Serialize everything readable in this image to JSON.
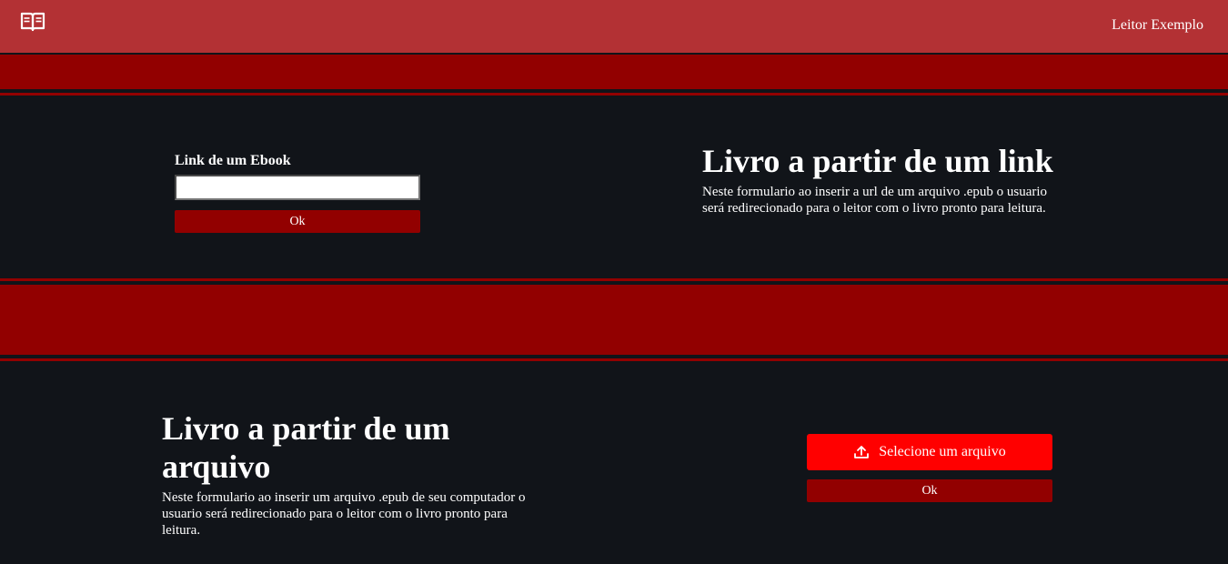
{
  "header": {
    "logo_icon": "open-book-icon",
    "brand": "Leitor Exemplo"
  },
  "link_section": {
    "label": "Link de um Ebook",
    "input_value": "",
    "ok_label": "Ok",
    "title": "Livro a partir de um link",
    "description": "Neste formulario ao inserir a url de um arquivo .epub o usuario será redirecionado para o leitor com o livro pronto para leitura."
  },
  "file_section": {
    "title": "Livro a partir de um arquivo",
    "description": "Neste formulario ao inserir um arquivo .epub de seu computador o usuario será redirecionado para o leitor com o livro pronto para leitura.",
    "select_icon": "upload-icon",
    "select_label": "Selecione um arquivo",
    "ok_label": "Ok"
  },
  "colors": {
    "header_bg": "#b33134",
    "band": "#920000",
    "background": "#111419",
    "select_button": "#ff0000"
  }
}
